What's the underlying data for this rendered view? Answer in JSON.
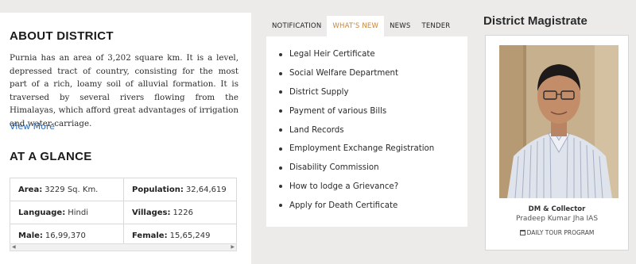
{
  "about": {
    "title": "ABOUT DISTRICT",
    "text": "Purnia has an area of 3,202 square km. It is a level, depressed tract of country, consisting for the most part of a rich, loamy soil of alluvial formation. It is traversed by several rivers flowing from the Himalayas, which afford great advantages of irrigation and water-carriage.",
    "view_more": "View More"
  },
  "glance": {
    "title": "AT A GLANCE",
    "rows": [
      [
        {
          "label": "Area:",
          "value": "3229 Sq. Km."
        },
        {
          "label": "Population:",
          "value": "32,64,619"
        }
      ],
      [
        {
          "label": "Language:",
          "value": "Hindi"
        },
        {
          "label": "Villages:",
          "value": "1226"
        }
      ],
      [
        {
          "label": "Male:",
          "value": "16,99,370"
        },
        {
          "label": "Female:",
          "value": "15,65,249"
        }
      ]
    ]
  },
  "tabs": {
    "items": [
      "NOTIFICATION",
      "WHAT'S NEW",
      "NEWS",
      "TENDER"
    ],
    "active": "WHAT'S NEW",
    "active_color": "#c8843a"
  },
  "whats_new": [
    "Legal Heir Certificate",
    "Social Welfare Department",
    "District Supply",
    "Payment of various Bills",
    "Land Records",
    "Employment Exchange Registration",
    "Disability Commission",
    "How to lodge a Grievance?",
    "Apply for Death Certificate"
  ],
  "dm": {
    "title": "District Magistrate",
    "role": "DM & Collector",
    "name": "Pradeep Kumar Jha IAS",
    "tour_label": "DAILY TOUR PROGRAM"
  }
}
